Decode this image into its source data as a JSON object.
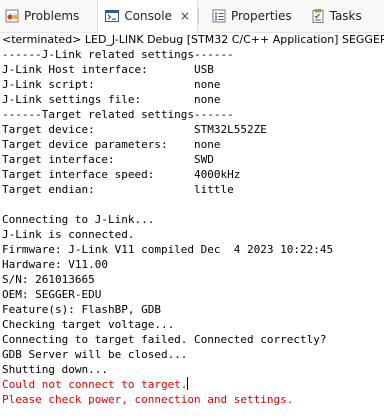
{
  "tabs": [
    {
      "label": "Problems",
      "icon": "problems-icon",
      "active": false
    },
    {
      "label": "Console",
      "icon": "console-icon",
      "active": true,
      "close": "×"
    },
    {
      "label": "Properties",
      "icon": "properties-icon",
      "active": false
    },
    {
      "label": "Tasks",
      "icon": "tasks-icon",
      "active": false
    }
  ],
  "header": "<terminated> LED_J-LINK Debug [STM32 C/C++ Application] SEGGER J-Link GDB Server",
  "console_lines": [
    {
      "text": "------J-Link related settings------",
      "error": false
    },
    {
      "text": "J-Link Host interface:       USB",
      "error": false
    },
    {
      "text": "J-Link script:               none",
      "error": false
    },
    {
      "text": "J-Link settings file:        none",
      "error": false
    },
    {
      "text": "------Target related settings------",
      "error": false
    },
    {
      "text": "Target device:               STM32L552ZE",
      "error": false
    },
    {
      "text": "Target device parameters:    none",
      "error": false
    },
    {
      "text": "Target interface:            SWD",
      "error": false
    },
    {
      "text": "Target interface speed:      4000kHz",
      "error": false
    },
    {
      "text": "Target endian:               little",
      "error": false
    },
    {
      "text": "",
      "error": false
    },
    {
      "text": "Connecting to J-Link...",
      "error": false
    },
    {
      "text": "J-Link is connected.",
      "error": false
    },
    {
      "text": "Firmware: J-Link V11 compiled Dec  4 2023 10:22:45",
      "error": false
    },
    {
      "text": "Hardware: V11.00",
      "error": false
    },
    {
      "text": "S/N: 261013665",
      "error": false
    },
    {
      "text": "OEM: SEGGER-EDU",
      "error": false
    },
    {
      "text": "Feature(s): FlashBP, GDB",
      "error": false
    },
    {
      "text": "Checking target voltage...",
      "error": false
    },
    {
      "text": "Connecting to target failed. Connected correctly?",
      "error": false
    },
    {
      "text": "GDB Server will be closed...",
      "error": false
    },
    {
      "text": "Shutting down...",
      "error": false
    },
    {
      "text": "Could not connect to target.",
      "error": true
    },
    {
      "text": "Please check power, connection and settings.",
      "error": true
    }
  ],
  "colors": {
    "error_text": "#e00000",
    "normal_text": "#000000"
  }
}
